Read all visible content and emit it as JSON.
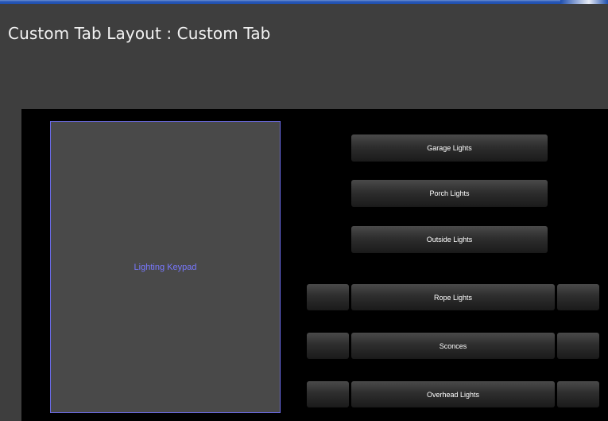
{
  "title": "Custom Tab Layout : Custom Tab",
  "keypad": {
    "label": "Lighting Keypad"
  },
  "buttons": {
    "garage": "Garage Lights",
    "porch": "Porch Lights",
    "outside": "Outside Lights",
    "rope": "Rope Lights",
    "sconces": "Sconces",
    "overhead": "Overhead Lights"
  },
  "colors": {
    "page_background": "#3e3e3e",
    "canvas_background": "#000000",
    "keypad_fill": "#494949",
    "keypad_border": "#6a6ae6",
    "keypad_text": "#7878ff",
    "title_text": "#f2f2f2",
    "button_text": "#ffffff"
  }
}
